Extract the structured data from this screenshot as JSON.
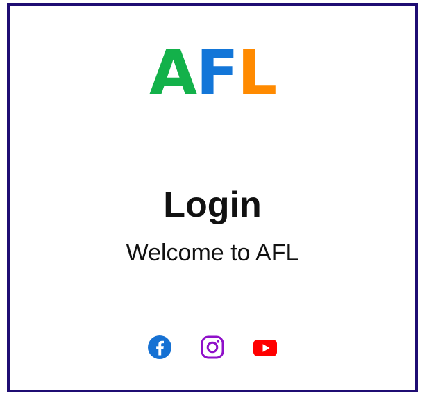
{
  "logo": {
    "letters": [
      "A",
      "F",
      "L"
    ],
    "colors": [
      "#13b14a",
      "#1376d8",
      "#ff8a00"
    ]
  },
  "header": {
    "title": "Login",
    "subtitle": "Welcome to AFL"
  },
  "social": {
    "facebook": {
      "icon": "facebook-icon",
      "color": "#1671d3"
    },
    "instagram": {
      "icon": "instagram-icon",
      "color": "#8f10c9"
    },
    "youtube": {
      "icon": "youtube-icon",
      "color": "#ff0000"
    }
  },
  "frame": {
    "border_color": "#1f0d73"
  }
}
